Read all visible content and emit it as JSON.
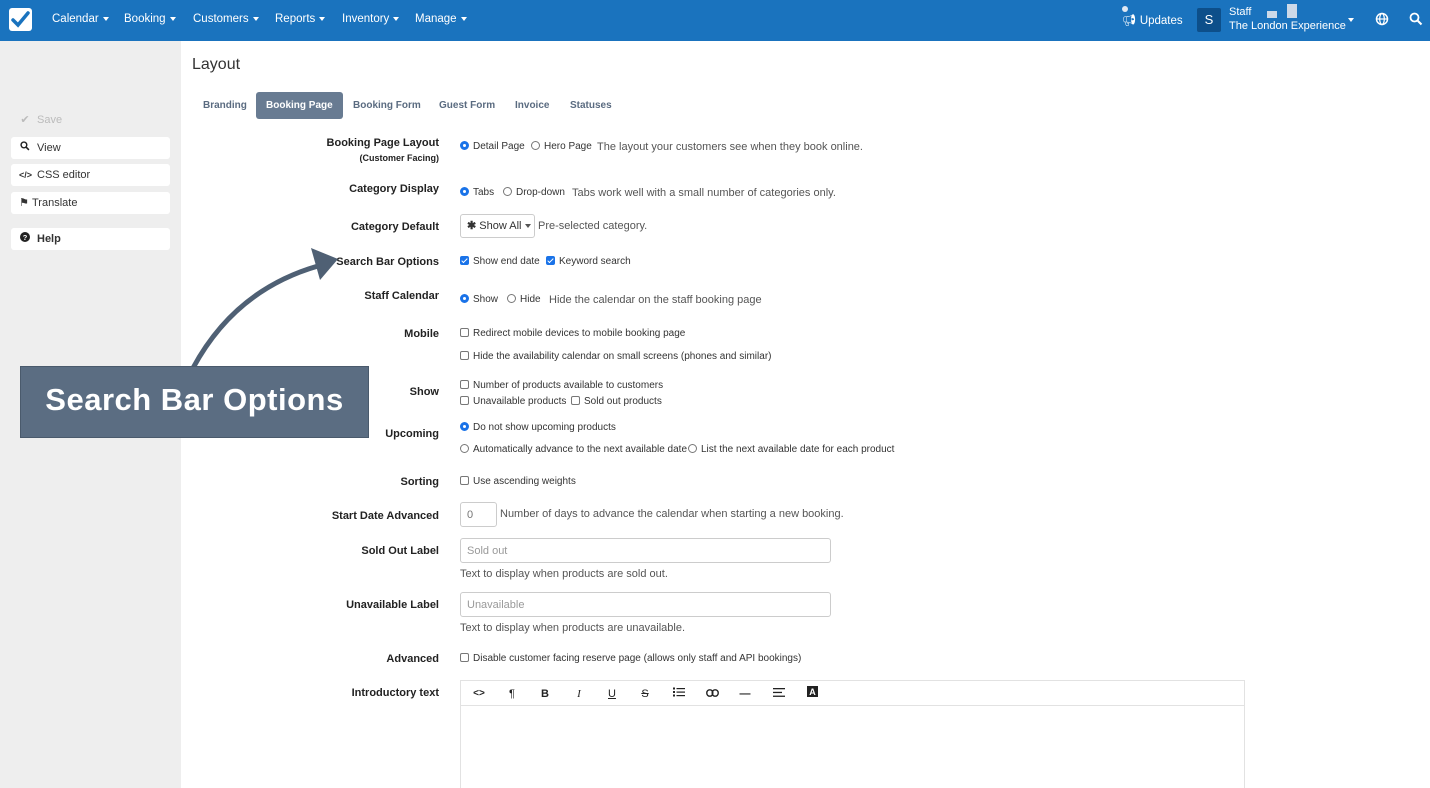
{
  "topbar": {
    "menus": [
      {
        "label": "Calendar"
      },
      {
        "label": "Booking"
      },
      {
        "label": "Customers"
      },
      {
        "label": "Reports"
      },
      {
        "label": "Inventory"
      },
      {
        "label": "Manage"
      }
    ],
    "updates_label": "Updates",
    "avatar_initial": "S",
    "staff_role": "Staff",
    "staff_org": "The London Experience",
    "brand_color": "#1a73be"
  },
  "sidebar": {
    "save": "Save",
    "view": "View",
    "css_editor": "CSS editor",
    "translate": "Translate",
    "help": "Help"
  },
  "page": {
    "title": "Layout",
    "tabs": [
      {
        "label": "Branding",
        "active": false
      },
      {
        "label": "Booking Page",
        "active": true
      },
      {
        "label": "Booking Form",
        "active": false
      },
      {
        "label": "Guest Form",
        "active": false
      },
      {
        "label": "Invoice",
        "active": false
      },
      {
        "label": "Statuses",
        "active": false
      }
    ]
  },
  "form": {
    "booking_page_layout": {
      "label": "Booking Page Layout",
      "sublabel": "(Customer Facing)",
      "options": [
        "Detail Page",
        "Hero Page"
      ],
      "selected": "Detail Page",
      "help": "The layout your customers see when they book online."
    },
    "category_display": {
      "label": "Category Display",
      "options": [
        "Tabs",
        "Drop-down"
      ],
      "selected": "Tabs",
      "help": "Tabs work well with a small number of categories only."
    },
    "category_default": {
      "label": "Category Default",
      "value": "Show All",
      "help": "Pre-selected category."
    },
    "search_bar_options": {
      "label": "Search Bar Options",
      "options": [
        {
          "label": "Show end date",
          "checked": true
        },
        {
          "label": "Keyword search",
          "checked": true
        }
      ]
    },
    "staff_calendar": {
      "label": "Staff Calendar",
      "options": [
        "Show",
        "Hide"
      ],
      "selected": "Show",
      "help": "Hide the calendar on the staff booking page"
    },
    "mobile": {
      "label": "Mobile",
      "options": [
        {
          "label": "Redirect mobile devices to mobile booking page",
          "checked": false
        },
        {
          "label": "Hide the availability calendar on small screens (phones and similar)",
          "checked": false
        }
      ]
    },
    "show": {
      "label": "Show",
      "options": [
        {
          "label": "Number of products available to customers",
          "checked": false
        },
        {
          "label": "Unavailable products",
          "checked": false
        },
        {
          "label": "Sold out products",
          "checked": false
        }
      ]
    },
    "upcoming": {
      "label": "Upcoming",
      "options": [
        {
          "label": "Do not show upcoming products",
          "selected": true
        },
        {
          "label": "Automatically advance to the next available date",
          "selected": false
        },
        {
          "label": "List the next available date for each product",
          "selected": false
        }
      ]
    },
    "sorting": {
      "label": "Sorting",
      "option": "Use ascending weights",
      "checked": false
    },
    "start_date_advanced": {
      "label": "Start Date Advanced",
      "placeholder": "0",
      "help": "Number of days to advance the calendar when starting a new booking."
    },
    "sold_out_label": {
      "label": "Sold Out Label",
      "placeholder": "Sold out",
      "help": "Text to display when products are sold out."
    },
    "unavailable_label": {
      "label": "Unavailable Label",
      "placeholder": "Unavailable",
      "help": "Text to display when products are unavailable."
    },
    "advanced": {
      "label": "Advanced",
      "option": "Disable customer facing reserve page (allows only staff and API bookings)",
      "checked": false
    },
    "introductory_text": {
      "label": "Introductory text",
      "toolbar": [
        "<>",
        "¶",
        "B",
        "I",
        "U",
        "S",
        "list",
        "link",
        "—",
        "align",
        "A"
      ]
    }
  },
  "annotation": {
    "text": "Search Bar Options"
  }
}
